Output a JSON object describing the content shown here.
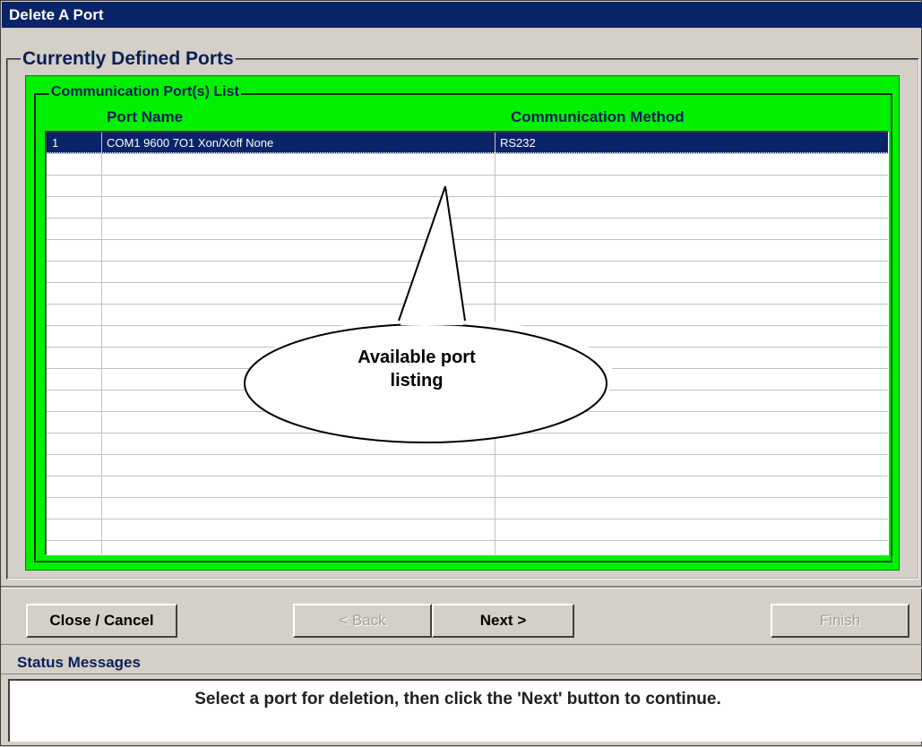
{
  "window": {
    "title": "Delete A Port"
  },
  "outer_group": {
    "label": "Currently Defined Ports"
  },
  "inner_group": {
    "label": "Communication Port(s) List"
  },
  "grid": {
    "columns": [
      "Port Name",
      "Communication Method"
    ],
    "rows": [
      {
        "index": "1",
        "port_name": "COM1 9600 7O1 Xon/Xoff None",
        "method": "RS232",
        "selected": true
      }
    ],
    "empty_rows": 18
  },
  "callout": {
    "text": "Available port\nlisting"
  },
  "buttons": {
    "close": "Close / Cancel",
    "back": "< Back",
    "next": "Next >",
    "finish": "Finish"
  },
  "status": {
    "header": "Status Messages",
    "message": "Select a port for deletion, then click the 'Next' button to continue."
  },
  "colors": {
    "titlebar": "#0a246a",
    "panel_green": "#00f000",
    "selection": "#0a246a"
  }
}
